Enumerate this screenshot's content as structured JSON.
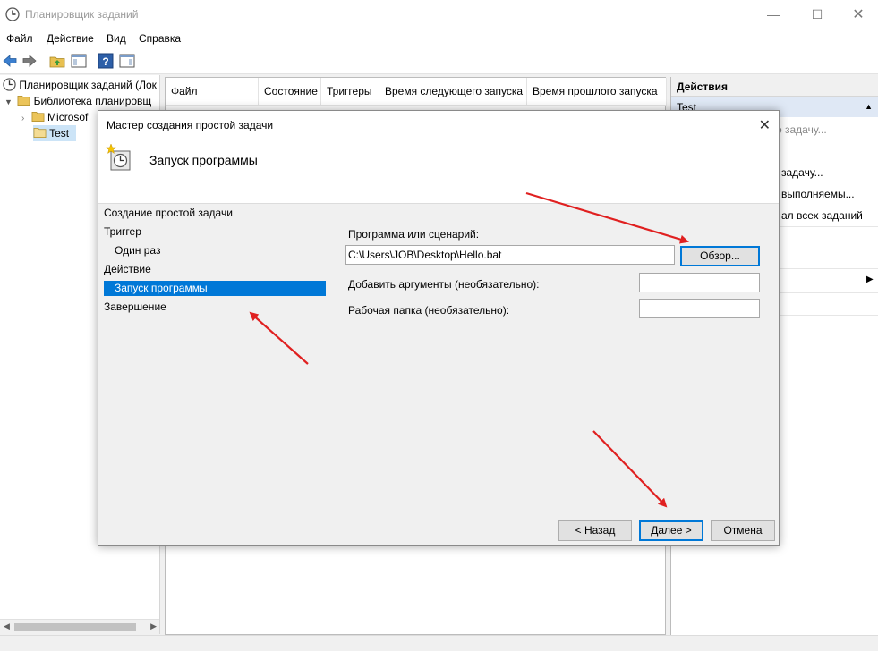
{
  "window": {
    "title": "Планировщик заданий",
    "min_glyph": "—",
    "max_glyph": "☐",
    "close_glyph": "✕"
  },
  "menu": [
    "Файл",
    "Действие",
    "Вид",
    "Справка"
  ],
  "tree": {
    "root": "Планировщик заданий (Лок",
    "library": "Библиотека планировщ",
    "microsoft": "Microsof",
    "test": "Test"
  },
  "columns": [
    "Файл",
    "Состояние",
    "Триггеры",
    "Время следующего запуска",
    "Время прошлого запуска"
  ],
  "actions_pane": {
    "title": "Действия",
    "section": "Test",
    "items": [
      "о задачу...",
      "задачу...",
      "выполняемы...",
      "ал всех заданий"
    ]
  },
  "dialog": {
    "title": "Мастер создания простой задачи",
    "header": "Запуск программы",
    "close_glyph": "✕",
    "steps": [
      "Создание простой задачи",
      "Триггер",
      "Один раз",
      "Действие",
      "Запуск программы",
      "Завершение"
    ],
    "program_label": "Программа или сценарий:",
    "program_value": "C:\\Users\\JOB\\Desktop\\Hello.bat",
    "browse_label": "Обзор...",
    "args_label": "Добавить аргументы (необязательно):",
    "args_value": "",
    "folder_label": "Рабочая папка (необязательно):",
    "folder_value": "",
    "back_label": "< Назад",
    "next_label": "Далее >",
    "cancel_label": "Отмена"
  },
  "colors": {
    "selection": "#0078d7",
    "annotation_arrow": "#e02020"
  }
}
